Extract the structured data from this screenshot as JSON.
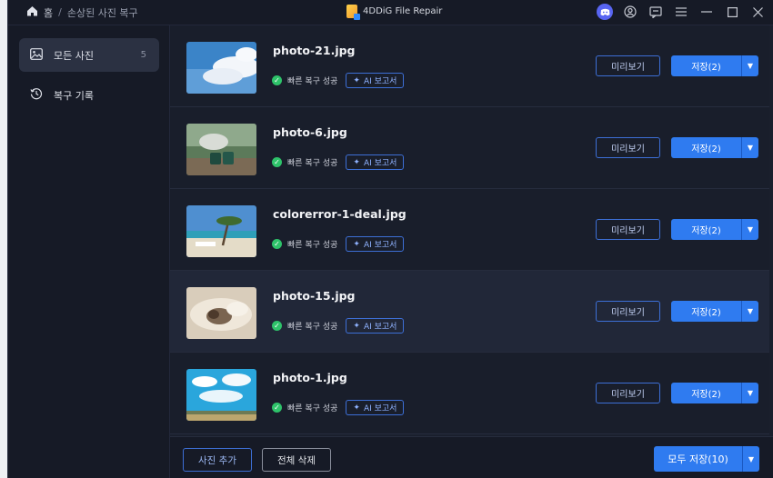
{
  "breadcrumb": {
    "home": "홈",
    "separator": "/",
    "current": "손상된 사진 복구"
  },
  "app": {
    "title": "4DDiG File Repair"
  },
  "window_icons": [
    "discord-icon",
    "user-icon",
    "feedback-icon",
    "menu-icon",
    "minimize-icon",
    "maximize-icon",
    "close-icon"
  ],
  "sidebar": {
    "items": [
      {
        "label": "모든 사진",
        "count": "5",
        "icon": "image-icon"
      },
      {
        "label": "복구 기록",
        "icon": "history-icon"
      }
    ]
  },
  "files": [
    {
      "name": "photo-21.jpg",
      "status": "빠른 복구 성공",
      "ai_label": "AI 보고서",
      "preview_label": "미리보기",
      "save_label": "저장(2)"
    },
    {
      "name": "photo-6.jpg",
      "status": "빠른 복구 성공",
      "ai_label": "AI 보고서",
      "preview_label": "미리보기",
      "save_label": "저장(2)"
    },
    {
      "name": "colorerror-1-deal.jpg",
      "status": "빠른 복구 성공",
      "ai_label": "AI 보고서",
      "preview_label": "미리보기",
      "save_label": "저장(2)"
    },
    {
      "name": "photo-15.jpg",
      "status": "빠른 복구 성공",
      "ai_label": "AI 보고서",
      "preview_label": "미리보기",
      "save_label": "저장(2)"
    },
    {
      "name": "photo-1.jpg",
      "status": "빠른 복구 성공",
      "ai_label": "AI 보고서",
      "preview_label": "미리보기",
      "save_label": "저장(2)"
    }
  ],
  "footer": {
    "add_label": "사진 추가",
    "delete_all_label": "전체 삭제",
    "save_all_label": "모두 저장(10)"
  },
  "colors": {
    "accent": "#2f7bf0",
    "success": "#2ec36a",
    "background": "#161a26"
  }
}
